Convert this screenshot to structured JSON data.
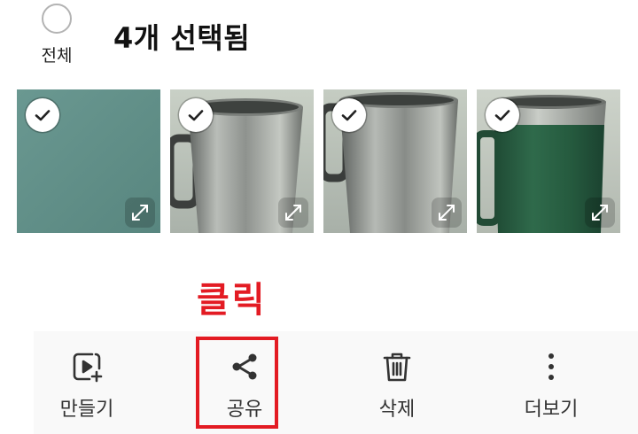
{
  "header": {
    "select_all_label": "전체",
    "title": "4개 선택됨"
  },
  "photos": [
    {
      "subject": "plain teal surface",
      "selected": true,
      "check_icon": "check-icon",
      "expand_icon": "expand-icon"
    },
    {
      "subject": "stainless steel mug",
      "selected": true,
      "check_icon": "check-icon",
      "expand_icon": "expand-icon"
    },
    {
      "subject": "stainless steel mug",
      "selected": true,
      "check_icon": "check-icon",
      "expand_icon": "expand-icon"
    },
    {
      "subject": "green and steel mug",
      "selected": true,
      "check_icon": "check-icon",
      "expand_icon": "expand-icon"
    }
  ],
  "annotation": {
    "text": "클릭",
    "color": "#e31b23"
  },
  "bottom_bar": {
    "items": [
      {
        "label": "만들기",
        "icon": "create-video-icon"
      },
      {
        "label": "공유",
        "icon": "share-icon",
        "highlighted": true
      },
      {
        "label": "삭제",
        "icon": "trash-icon"
      },
      {
        "label": "더보기",
        "icon": "more-vertical-icon"
      }
    ]
  }
}
